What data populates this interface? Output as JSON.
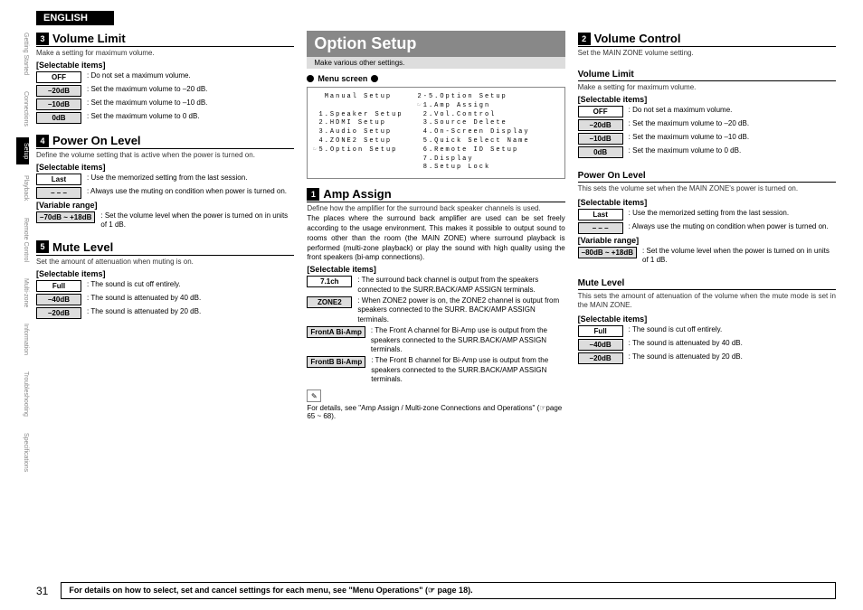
{
  "lang_label": "ENGLISH",
  "side_tabs": [
    "Getting Started",
    "Connections",
    "Setup",
    "Playback",
    "Remote Control",
    "Multi-zone",
    "Information",
    "Troubleshooting",
    "Specifications"
  ],
  "active_tab_index": 2,
  "col1": {
    "volume_limit": {
      "num": "3",
      "title": "Volume Limit",
      "caption": "Make a setting for maximum volume.",
      "sel_head": "[Selectable items]",
      "items": [
        {
          "tag": "OFF",
          "filled": false,
          "desc": "Do not set a maximum volume."
        },
        {
          "tag": "–20dB",
          "filled": true,
          "desc": "Set the maximum volume to –20 dB."
        },
        {
          "tag": "–10dB",
          "filled": true,
          "desc": "Set the maximum volume to –10 dB."
        },
        {
          "tag": "0dB",
          "filled": true,
          "desc": "Set the maximum volume to 0 dB."
        }
      ]
    },
    "power_on": {
      "num": "4",
      "title": "Power On Level",
      "caption": "Define the volume setting that is active when the power is turned on.",
      "sel_head": "[Selectable items]",
      "items": [
        {
          "tag": "Last",
          "filled": false,
          "desc": "Use the memorized setting from the last session."
        },
        {
          "tag": "– – –",
          "filled": true,
          "desc": "Always use the muting on condition when power is turned on."
        }
      ],
      "var_head": "[Variable range]",
      "var_items": [
        {
          "tag": "–70dB ~ +18dB",
          "filled": true,
          "desc": "Set the volume level when the power is turned on in units of 1 dB."
        }
      ]
    },
    "mute": {
      "num": "5",
      "title": "Mute Level",
      "caption": "Set the amount of attenuation when muting is on.",
      "sel_head": "[Selectable items]",
      "items": [
        {
          "tag": "Full",
          "filled": false,
          "desc": "The sound is cut off entirely."
        },
        {
          "tag": "–40dB",
          "filled": true,
          "desc": "The sound is attenuated by 40 dB."
        },
        {
          "tag": "–20dB",
          "filled": true,
          "desc": "The sound is attenuated by 20 dB."
        }
      ]
    }
  },
  "col2": {
    "big_title": "Option Setup",
    "big_sub": "Make various other settings.",
    "menu_head": "Menu screen",
    "menu_left": "  Manual Setup\n\n 1.Speaker Setup\n 2.HDMI Setup\n 3.Audio Setup\n 4.ZONE2 Setup\n☞5.Option Setup",
    "menu_right": "2-5.Option Setup\n☞1.Amp Assign\n 2.Vol.Control\n 3.Source Delete\n 4.On-Screen Display\n 5.Quick Select Name\n 6.Remote ID Setup\n 7.Display\n 8.Setup Lock",
    "amp": {
      "num": "1",
      "title": "Amp Assign",
      "caption": "Define how the amplifier for the surround back speaker channels is used.",
      "body": "The places where the surround back amplifier are used can be set freely according to the usage environment. This makes it possible to output sound to rooms other than the room (the MAIN ZONE) where surround playback is performed (multi-zone playback) or play the sound with high quality using the front speakers (bi-amp connections).",
      "sel_head": "[Selectable items]",
      "items": [
        {
          "tag": "7.1ch",
          "filled": false,
          "desc": "The surround back channel is output from the speakers connected to the SURR.BACK/AMP ASSIGN terminals."
        },
        {
          "tag": "ZONE2",
          "filled": true,
          "desc": "When ZONE2 power is on, the ZONE2 channel is output from speakers connected to the SURR. BACK/AMP ASSIGN terminals."
        },
        {
          "tag": "FrontA Bi-Amp",
          "filled": true,
          "desc": "The Front A channel for Bi-Amp use is output from the speakers connected to the SURR.BACK/AMP ASSIGN terminals."
        },
        {
          "tag": "FrontB Bi-Amp",
          "filled": true,
          "desc": "The Front B channel for Bi-Amp use is output from the speakers connected to the SURR.BACK/AMP ASSIGN terminals."
        }
      ],
      "ref": "For details, see \"Amp Assign / Multi-zone Connections and Operations\" (☞page 65 ~ 68)."
    }
  },
  "col3": {
    "volume_control": {
      "num": "2",
      "title": "Volume Control",
      "caption": "Set the MAIN ZONE volume setting."
    },
    "volume_limit": {
      "title": "Volume Limit",
      "caption": "Make a setting for maximum volume.",
      "sel_head": "[Selectable items]",
      "items": [
        {
          "tag": "OFF",
          "filled": false,
          "desc": "Do not set a maximum volume."
        },
        {
          "tag": "–20dB",
          "filled": true,
          "desc": "Set the maximum volume to –20 dB."
        },
        {
          "tag": "–10dB",
          "filled": true,
          "desc": "Set the maximum volume to –10 dB."
        },
        {
          "tag": "0dB",
          "filled": true,
          "desc": "Set the maximum volume to 0 dB."
        }
      ]
    },
    "power_on": {
      "title": "Power On Level",
      "caption": "This sets the volume set when the MAIN ZONE's power is turned on.",
      "sel_head": "[Selectable items]",
      "items": [
        {
          "tag": "Last",
          "filled": false,
          "desc": "Use the memorized setting from the last session."
        },
        {
          "tag": "– – –",
          "filled": true,
          "desc": "Always use the muting on condition when power is turned on."
        }
      ],
      "var_head": "[Variable range]",
      "var_items": [
        {
          "tag": "–80dB ~ +18dB",
          "filled": true,
          "desc": "Set the volume level when the power is turned on in units of 1 dB."
        }
      ]
    },
    "mute": {
      "title": "Mute Level",
      "caption": "This sets the amount of attenuation of the volume when the mute mode is set in the MAIN ZONE.",
      "sel_head": "[Selectable items]",
      "items": [
        {
          "tag": "Full",
          "filled": false,
          "desc": "The sound is cut off entirely."
        },
        {
          "tag": "–40dB",
          "filled": true,
          "desc": "The sound is attenuated by 40 dB."
        },
        {
          "tag": "–20dB",
          "filled": true,
          "desc": "The sound is attenuated by 20 dB."
        }
      ]
    }
  },
  "footer": {
    "page": "31",
    "text": "For details on how to select, set and cancel settings for each menu, see \"Menu Operations\" (☞ page 18)."
  }
}
